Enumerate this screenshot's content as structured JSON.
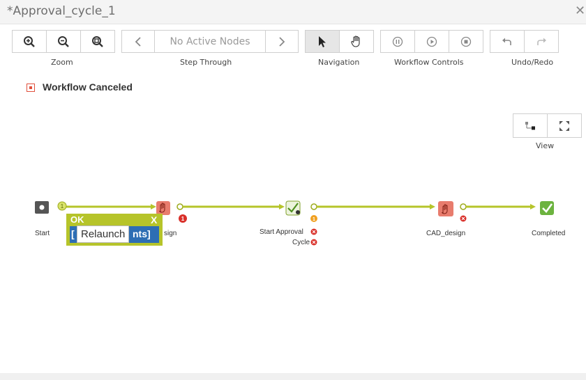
{
  "window": {
    "title": "*Approval_cycle_1"
  },
  "toolbar": {
    "groups": {
      "zoom": "Zoom",
      "step_through": "Step Through",
      "navigation": "Navigation",
      "workflow_controls": "Workflow Controls",
      "undo_redo": "Undo/Redo"
    },
    "no_active_nodes": "No Active Nodes"
  },
  "status": {
    "text": "Workflow Canceled",
    "color": "#e0503c"
  },
  "view_panel": {
    "label": "View"
  },
  "workflow": {
    "nodes": {
      "start": "Start",
      "design_partial": "sign",
      "start_approval_line1": "Start Approval",
      "start_approval_line2": "Cycle",
      "cad_design": "CAD_design",
      "completed": "Completed"
    },
    "connector_badge": "1",
    "error_badge": "1",
    "warning_badge": "1"
  },
  "popup": {
    "ok": "OK",
    "close": "X",
    "field_left": "[",
    "field_right": "nts]"
  },
  "tooltip": {
    "text": "Relaunch"
  },
  "colors": {
    "connector": "#b6c42a",
    "error": "#e0503c",
    "warning": "#f0a020",
    "node_dark": "#555555",
    "completed_green": "#6cb33f"
  }
}
